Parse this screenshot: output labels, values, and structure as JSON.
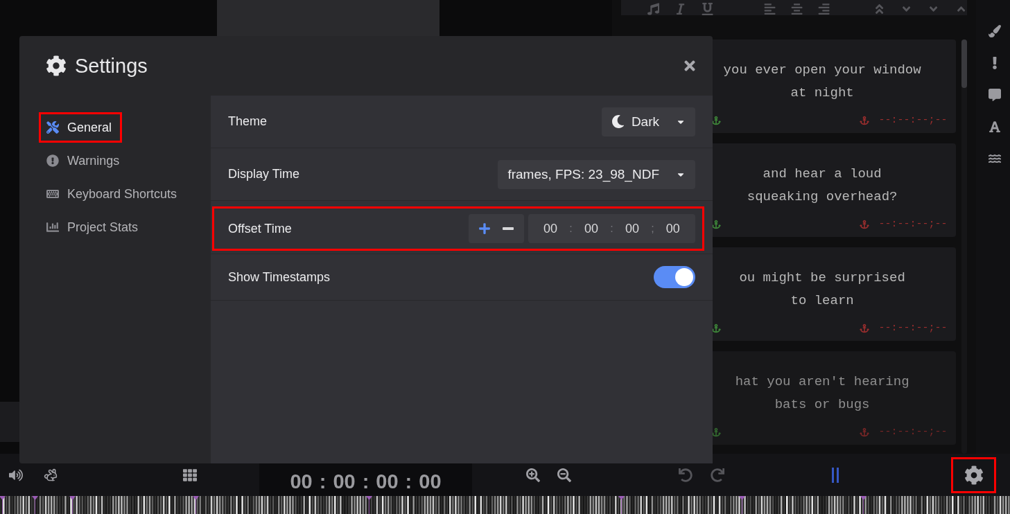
{
  "modal": {
    "title": "Settings",
    "nav": [
      {
        "kind": "general",
        "label": "General",
        "selected": true,
        "highlighted": true
      },
      {
        "kind": "warnings",
        "label": "Warnings",
        "selected": false,
        "highlighted": false
      },
      {
        "kind": "shortcuts",
        "label": "Keyboard Shortcuts",
        "selected": false,
        "highlighted": false
      },
      {
        "kind": "stats",
        "label": "Project Stats",
        "selected": false,
        "highlighted": false
      }
    ],
    "settings": [
      {
        "kind": "theme",
        "label": "Theme",
        "value": "Dark"
      },
      {
        "kind": "select",
        "label": "Display Time",
        "value": "frames, FPS: 23_98_NDF"
      },
      {
        "kind": "offset",
        "label": "Offset Time",
        "highlighted": true,
        "fields": [
          "00",
          "00",
          "00",
          "00"
        ],
        "separators": [
          ":",
          ":",
          ";"
        ]
      },
      {
        "kind": "toggle",
        "label": "Show Timestamps",
        "on": true
      }
    ]
  },
  "captions": [
    {
      "lines": [
        "you ever open your window",
        "at night"
      ],
      "out_time": "--:--:--;--"
    },
    {
      "lines": [
        "and hear a loud",
        "squeaking overhead?"
      ],
      "out_time": "--:--:--;--"
    },
    {
      "lines": [
        "ou might be surprised",
        "to learn"
      ],
      "out_time": "--:--:--;--"
    },
    {
      "lines": [
        "hat you aren't hearing",
        "bats or bugs"
      ],
      "out_time": "--:--:--;--"
    }
  ],
  "timecode": {
    "values": [
      "00",
      "00",
      "00",
      "00"
    ],
    "separators": [
      ":",
      ":",
      ":"
    ]
  },
  "toolbar": {
    "settings_highlighted": true
  }
}
